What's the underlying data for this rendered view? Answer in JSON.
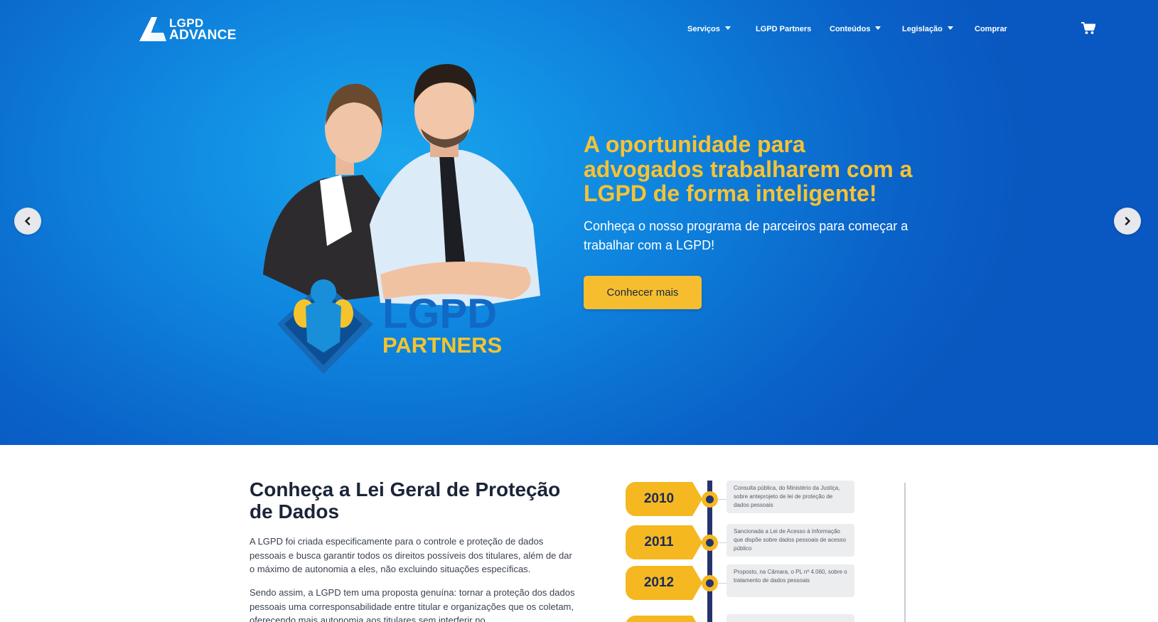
{
  "header": {
    "logo_line1": "LGPD",
    "logo_line2": "ADVANCE",
    "nav": [
      {
        "label": "Serviços",
        "dropdown": true
      },
      {
        "label": "LGPD Partners",
        "dropdown": false
      },
      {
        "label": "Conteúdos",
        "dropdown": true
      },
      {
        "label": "Legislação",
        "dropdown": true
      },
      {
        "label": "Comprar",
        "dropdown": false
      }
    ],
    "cart_icon": "shopping-cart-icon"
  },
  "hero": {
    "title": "A oportunidade para advogados trabalharem com a LGPD de forma inteligente!",
    "subtitle": "Conheça o nosso programa de parceiros para começar a trabalhar com a LGPD!",
    "cta_label": "Conhecer mais",
    "badge_line1": "LGPD",
    "badge_line2": "PARTNERS"
  },
  "about": {
    "title": "Conheça a Lei Geral de Proteção de Dados",
    "paragraph1": "A LGPD foi criada especificamente para o controle e proteção de dados pessoais e busca garantir todos os direitos possíveis dos titulares, além de dar o máximo de autonomia a eles, não excluindo situações específicas.",
    "paragraph2": "Sendo assim, a LGPD tem uma proposta genuína: tornar a proteção dos dados pessoais uma corresponsabilidade entre titular e organizações que os coletam, oferecendo mais autonomia aos titulares sem interferir no"
  },
  "timeline": [
    {
      "year": "2010",
      "text": "Consulta pública, do Ministério da Justiça, sobre anteprojeto de lei de proteção de dados pessoais"
    },
    {
      "year": "2011",
      "text": "Sancionada a Lei de Acesso à Informação que dispõe sobre dados pessoais de acesso público"
    },
    {
      "year": "2012",
      "text": "Proposto, na Câmara, o PL nº 4.060, sobre o tratamento de dados pessoais"
    },
    {
      "year": "",
      "text": ""
    }
  ],
  "colors": {
    "hero_blue": "#0f86df",
    "accent_yellow": "#f6bd2f",
    "navy": "#25336e",
    "heading_dark": "#1b2438"
  }
}
